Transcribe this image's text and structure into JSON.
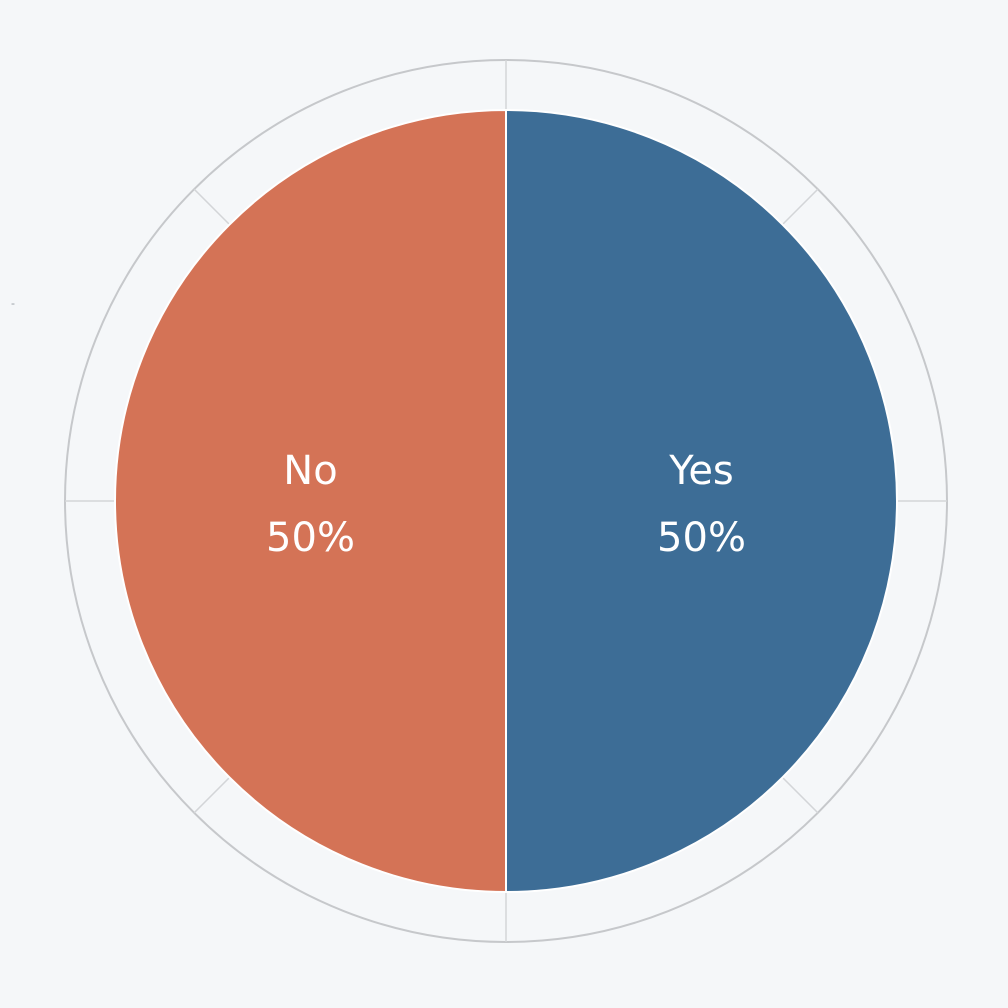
{
  "chart_data": {
    "type": "pie",
    "categories": [
      "Yes",
      "No"
    ],
    "values": [
      50,
      50
    ],
    "value_labels": [
      "50%",
      "50%"
    ],
    "colors": [
      "#3d6d96",
      "#d47356"
    ],
    "start_angle_deg": 0,
    "direction": "clockwise",
    "grid": true,
    "legend": "none"
  },
  "stray_mark": "-"
}
